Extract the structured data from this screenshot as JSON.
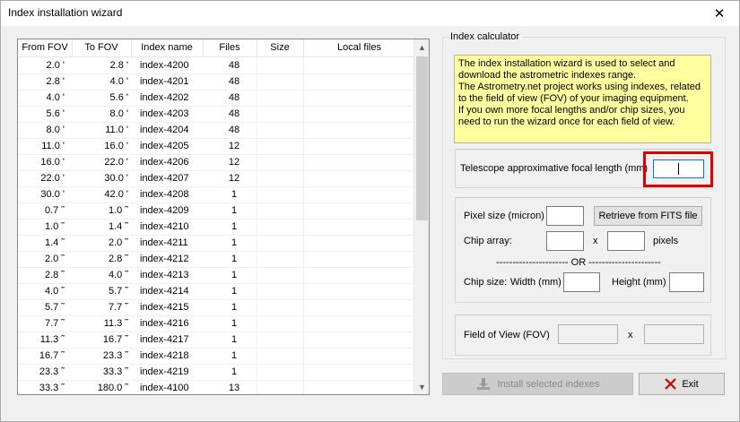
{
  "window": {
    "title": "Index installation wizard",
    "close_glyph": "✕"
  },
  "table": {
    "headers": {
      "from_fov": "From FOV",
      "to_fov": "To FOV",
      "index_name": "Index name",
      "files": "Files",
      "size": "Size",
      "local_files": "Local files"
    },
    "rows": [
      {
        "from": "2.0 '",
        "to": "2.8 '",
        "name": "index-4200",
        "files": "48"
      },
      {
        "from": "2.8 '",
        "to": "4.0 '",
        "name": "index-4201",
        "files": "48"
      },
      {
        "from": "4.0 '",
        "to": "5.6 '",
        "name": "index-4202",
        "files": "48"
      },
      {
        "from": "5.6 '",
        "to": "8.0 '",
        "name": "index-4203",
        "files": "48"
      },
      {
        "from": "8.0 '",
        "to": "11.0 '",
        "name": "index-4204",
        "files": "48"
      },
      {
        "from": "11.0 '",
        "to": "16.0 '",
        "name": "index-4205",
        "files": "12"
      },
      {
        "from": "16.0 '",
        "to": "22.0 '",
        "name": "index-4206",
        "files": "12"
      },
      {
        "from": "22.0 '",
        "to": "30.0 '",
        "name": "index-4207",
        "files": "12"
      },
      {
        "from": "30.0 '",
        "to": "42.0 '",
        "name": "index-4208",
        "files": "1"
      },
      {
        "from": "0.7 ˜",
        "to": "1.0 ˜",
        "name": "index-4209",
        "files": "1"
      },
      {
        "from": "1.0 ˜",
        "to": "1.4 ˜",
        "name": "index-4210",
        "files": "1"
      },
      {
        "from": "1.4 ˜",
        "to": "2.0 ˜",
        "name": "index-4211",
        "files": "1"
      },
      {
        "from": "2.0 ˜",
        "to": "2.8 ˜",
        "name": "index-4212",
        "files": "1"
      },
      {
        "from": "2.8 ˜",
        "to": "4.0 ˜",
        "name": "index-4213",
        "files": "1"
      },
      {
        "from": "4.0 ˜",
        "to": "5.7 ˜",
        "name": "index-4214",
        "files": "1"
      },
      {
        "from": "5.7 ˜",
        "to": "7.7 ˜",
        "name": "index-4215",
        "files": "1"
      },
      {
        "from": "7.7 ˜",
        "to": "11.3 ˜",
        "name": "index-4216",
        "files": "1"
      },
      {
        "from": "11.3 ˜",
        "to": "16.7 ˜",
        "name": "index-4217",
        "files": "1"
      },
      {
        "from": "16.7 ˜",
        "to": "23.3 ˜",
        "name": "index-4218",
        "files": "1"
      },
      {
        "from": "23.3 ˜",
        "to": "33.3 ˜",
        "name": "index-4219",
        "files": "1"
      },
      {
        "from": "33.3 ˜",
        "to": "180.0 ˜",
        "name": "index-4100",
        "files": "13"
      }
    ]
  },
  "calculator": {
    "group_label": "Index calculator",
    "info_lines": [
      "The index installation wizard is used to select and",
      "download the astrometric indexes range.",
      "The Astrometry.net project works using indexes, related",
      "to the field of view (FOV) of your imaging equipment.",
      "If you own more focal lengths and/or chip sizes, you",
      "need to run the wizard once for each field of view."
    ],
    "focal_label": "Telescope approximative focal length (mm)",
    "pixel_size_label": "Pixel size (micron)",
    "retrieve_button": "Retrieve from FITS file",
    "chip_array_label": "Chip array:",
    "chip_array_x": "x",
    "pixels_label": "pixels",
    "or_separator": "---------------------- OR ----------------------",
    "chip_size_label": "Chip size:",
    "width_label": "Width (mm)",
    "height_label": "Height (mm)",
    "fov_label": "Field of View  (FOV)",
    "fov_x": "x"
  },
  "buttons": {
    "install": "Install selected indexes",
    "exit": "Exit"
  },
  "colors": {
    "info_background": "#ffffa0",
    "highlight_border": "#e00000",
    "exit_icon": "#d00000"
  },
  "icons": {
    "install": "install-icon",
    "exit": "exit-x-icon",
    "close": "close-icon"
  }
}
